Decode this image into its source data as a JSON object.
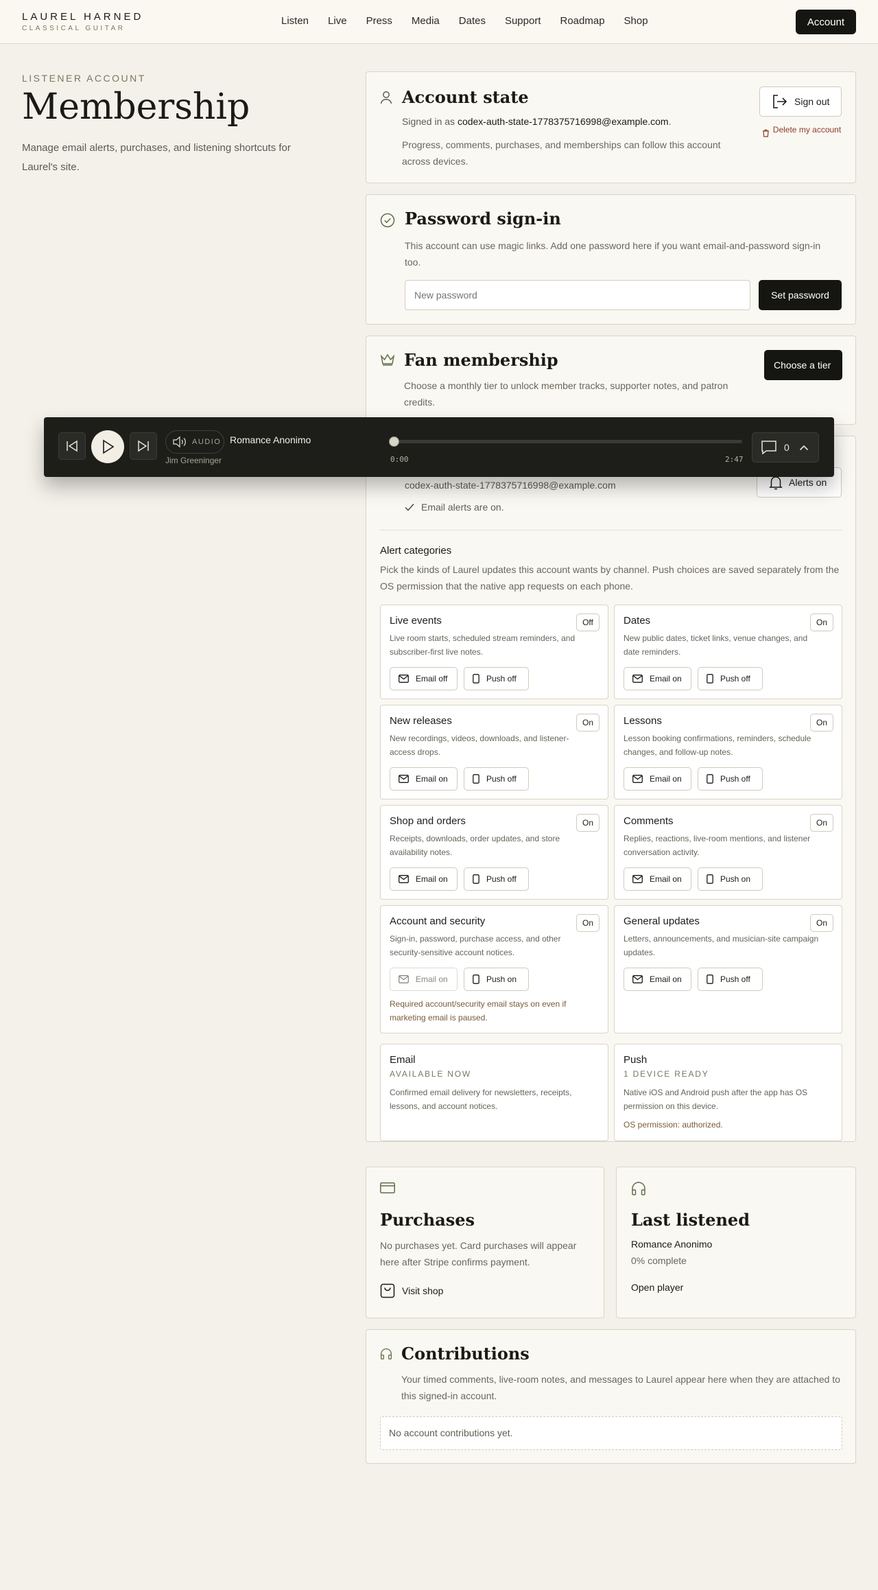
{
  "nav": {
    "brand_name": "LAUREL HARNED",
    "brand_sub": "CLASSICAL GUITAR",
    "links": [
      "Listen",
      "Live",
      "Press",
      "Media",
      "Dates",
      "Support",
      "Roadmap",
      "Shop"
    ],
    "account": "Account"
  },
  "intro": {
    "eyebrow": "LISTENER ACCOUNT",
    "title": "Membership",
    "lede": "Manage email alerts, purchases, and listening shortcuts for Laurel's site."
  },
  "account_state": {
    "title": "Account state",
    "signed_in_prefix": "Signed in as ",
    "email": "codex-auth-state-1778375716998@example.com",
    "signed_in_suffix": ".",
    "desc": "Progress, comments, purchases, and memberships can follow this account across devices.",
    "sign_out": "Sign out",
    "delete": "Delete my account"
  },
  "password": {
    "title": "Password sign-in",
    "desc": "This account can use magic links. Add one password here if you want email-and-password sign-in too.",
    "placeholder": "New password",
    "button": "Set password"
  },
  "membership": {
    "title": "Fan membership",
    "desc": "Choose a monthly tier to unlock member tracks, supporter notes, and patron credits.",
    "button": "Choose a tier"
  },
  "alerts": {
    "email": "codex-auth-state-1778375716998@example.com",
    "status": "Email alerts are on.",
    "button": "Alerts on",
    "categories_title": "Alert categories",
    "categories_desc": "Pick the kinds of Laurel updates this account wants by channel. Push choices are saved separately from the OS permission that the native app requests on each phone.",
    "categories": [
      {
        "title": "Live events",
        "state": "Off",
        "desc": "Live room starts, scheduled stream reminders, and subscriber-first live notes.",
        "email": "Email off",
        "push": "Push off"
      },
      {
        "title": "Dates",
        "state": "On",
        "desc": "New public dates, ticket links, venue changes, and date reminders.",
        "email": "Email on",
        "push": "Push off"
      },
      {
        "title": "New releases",
        "state": "On",
        "desc": "New recordings, videos, downloads, and listener-access drops.",
        "email": "Email on",
        "push": "Push off"
      },
      {
        "title": "Lessons",
        "state": "On",
        "desc": "Lesson booking confirmations, reminders, schedule changes, and follow-up notes.",
        "email": "Email on",
        "push": "Push off"
      },
      {
        "title": "Shop and orders",
        "state": "On",
        "desc": "Receipts, downloads, order updates, and store availability notes.",
        "email": "Email on",
        "push": "Push off"
      },
      {
        "title": "Comments",
        "state": "On",
        "desc": "Replies, reactions, live-room mentions, and listener conversation activity.",
        "email": "Email on",
        "push": "Push on"
      },
      {
        "title": "Account and security",
        "state": "On",
        "desc": "Sign-in, password, purchase access, and other security-sensitive account notices.",
        "email": "Email on",
        "push": "Push on",
        "note": "Required account/security email stays on even if marketing email is paused."
      },
      {
        "title": "General updates",
        "state": "On",
        "desc": "Letters, announcements, and musician-site campaign updates.",
        "email": "Email on",
        "push": "Push off"
      }
    ],
    "channels": {
      "email": {
        "title": "Email",
        "status": "AVAILABLE NOW",
        "desc": "Confirmed email delivery for newsletters, receipts, lessons, and account notices."
      },
      "push": {
        "title": "Push",
        "status": "1 DEVICE READY",
        "desc": "Native iOS and Android push after the app has OS permission on this device.",
        "permission": "OS permission: authorized."
      }
    }
  },
  "purchases": {
    "title": "Purchases",
    "desc": "No purchases yet. Card purchases will appear here after Stripe confirms payment.",
    "link": "Visit shop"
  },
  "last_listened": {
    "title": "Last listened",
    "track": "Romance Anonimo",
    "progress": "0% complete",
    "link": "Open player"
  },
  "contributions": {
    "title": "Contributions",
    "desc": "Your timed comments, live-room notes, and messages to Laurel appear here when they are attached to this signed-in account.",
    "empty": "No account contributions yet."
  },
  "player": {
    "audio_label": "AUDIO",
    "track": "Romance Anonimo",
    "artist": "Jim Greeninger",
    "elapsed": "0:00",
    "duration": "2:47",
    "progress": 0,
    "comments": "0"
  }
}
